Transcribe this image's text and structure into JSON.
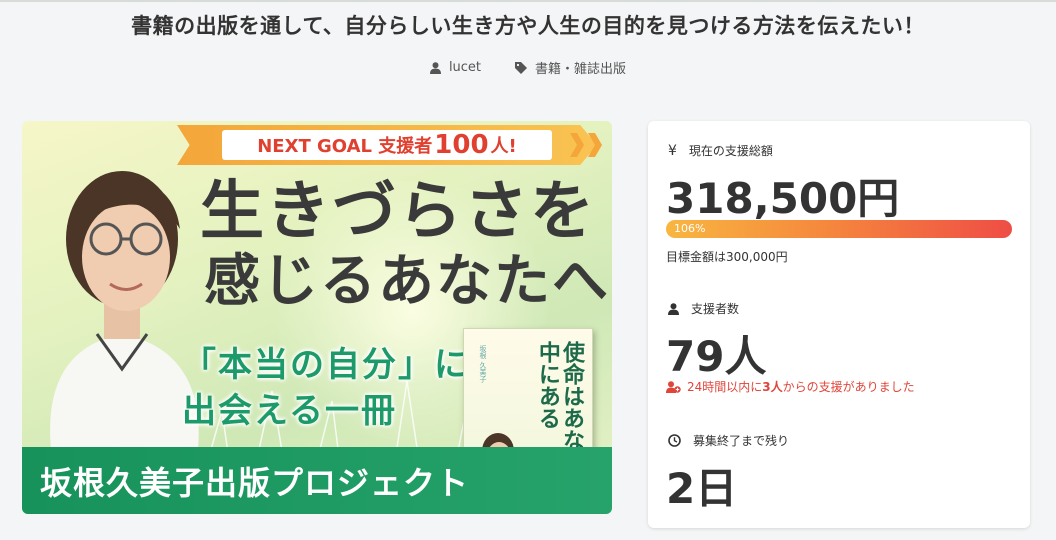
{
  "header": {
    "title": "書籍の出版を通して、自分らしい生き方や人生の目的を見つける方法を伝えたい！",
    "author": "lucet",
    "category": "書籍・雑誌出版"
  },
  "banner": {
    "goal_prefix": "NEXT GOAL 支援者",
    "goal_number": "100",
    "goal_suffix": "人!",
    "headline_line1": "生きづらさを",
    "headline_line2": "感じるあなたへ",
    "sub_line1": "「本当の自分」に",
    "sub_line2": "出会える一冊",
    "book_title": "使命はあなたの中にある",
    "book_author": "坂根 久美子",
    "footer": "坂根久美子出版プロジェクト"
  },
  "stats": {
    "amount_icon": "yen-icon",
    "amount_label": "現在の支援総額",
    "amount_value": "318,500円",
    "progress_label": "106%",
    "progress_value": 1.06,
    "target_text": "目標金額は300,000円",
    "supporters_label": "支援者数",
    "supporters_value": "79人",
    "recent_prefix": "24時間以内に",
    "recent_count": "3人",
    "recent_suffix": "からの支援がありました",
    "remaining_label": "募集終了まで残り",
    "remaining_value": "2日"
  },
  "colors": {
    "accent_red": "#e0453a",
    "banner_green": "#1d9a6a",
    "progress_start": "#f8b640",
    "progress_end": "#ef4d45"
  }
}
